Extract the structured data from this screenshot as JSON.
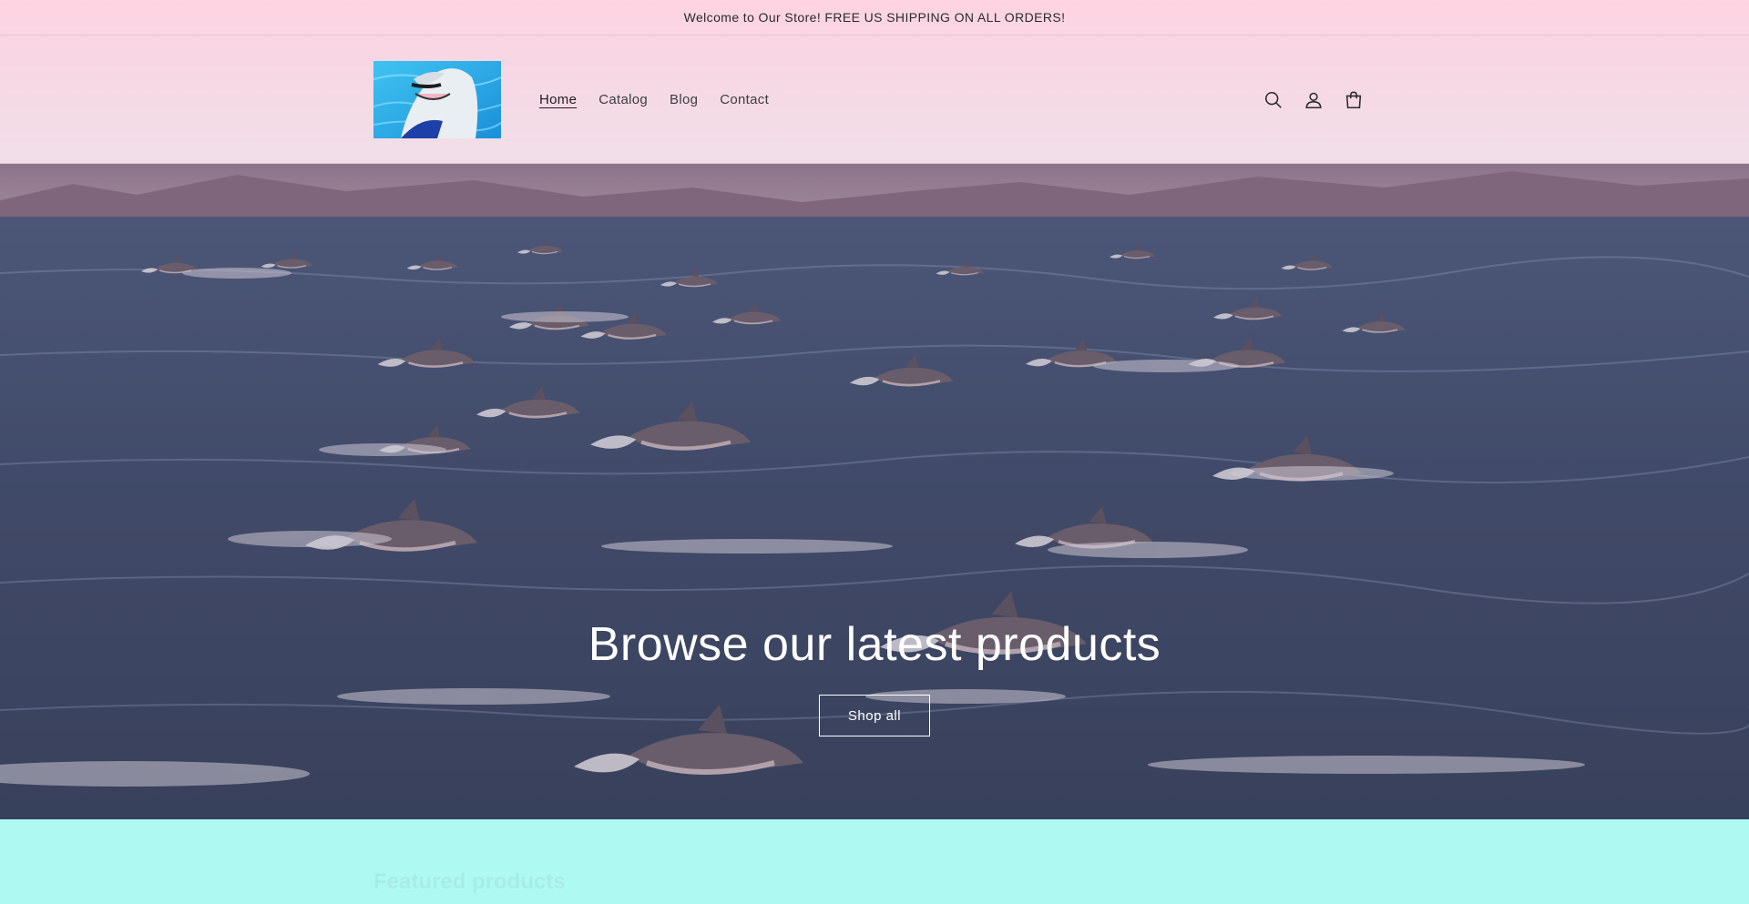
{
  "announcement": {
    "text": "Welcome to Our Store! FREE US SHIPPING ON ALL ORDERS!"
  },
  "header": {
    "logo_alt": "dolphin logo",
    "nav": [
      {
        "label": "Home",
        "active": true
      },
      {
        "label": "Catalog",
        "active": false
      },
      {
        "label": "Blog",
        "active": false
      },
      {
        "label": "Contact",
        "active": false
      }
    ],
    "icons": [
      "search-icon",
      "account-icon",
      "cart-icon"
    ]
  },
  "hero": {
    "title": "Browse our latest products",
    "button_label": "Shop all"
  },
  "featured": {
    "title": "Featured products"
  },
  "colors": {
    "announcement_bg": "#ffd3e1",
    "header_bg": "#f9d5e3",
    "featured_bg": "#aefaf3",
    "hero_text": "#ffffff"
  }
}
